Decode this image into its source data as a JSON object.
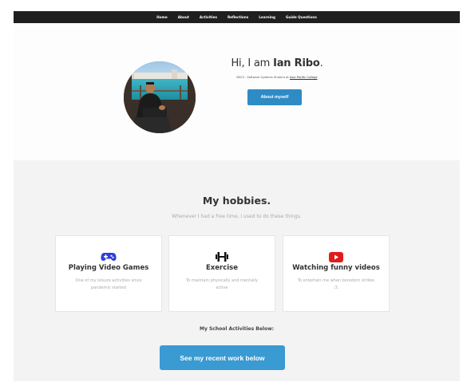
{
  "nav": {
    "items": [
      "Home",
      "About",
      "Activities",
      "Reflections",
      "Learning",
      "Guide Questions"
    ]
  },
  "hero": {
    "greeting": "Hi, I am ",
    "name": "Ian Ribo",
    "punct": ".",
    "subtitle_prefix": "BSCS - Software Systems Student at ",
    "school_link": "Asia Pacific College",
    "about_button": "About myself"
  },
  "hobbies": {
    "title": "My hobbies.",
    "subtitle": "Whenever I had a free time, I used to do these things.",
    "cards": [
      {
        "icon": "gamepad-icon",
        "title": "Playing Video Games",
        "desc": "One of my leisure activities since pandemic started"
      },
      {
        "icon": "dumbbell-icon",
        "title": "Exercise",
        "desc": "To maintain physically and mentally active"
      },
      {
        "icon": "youtube-icon",
        "title": "Watching funny videos",
        "desc": "To entertain me when boredom strikes :3."
      }
    ],
    "activities_label": "My School Activities Below:",
    "work_button": "See my recent work below"
  },
  "colors": {
    "navbar": "#1f1f1f",
    "button_blue": "#2f8bc4",
    "gamepad": "#2f3fd6",
    "youtube": "#e21b1b",
    "section_bg": "#f3f3f3"
  }
}
